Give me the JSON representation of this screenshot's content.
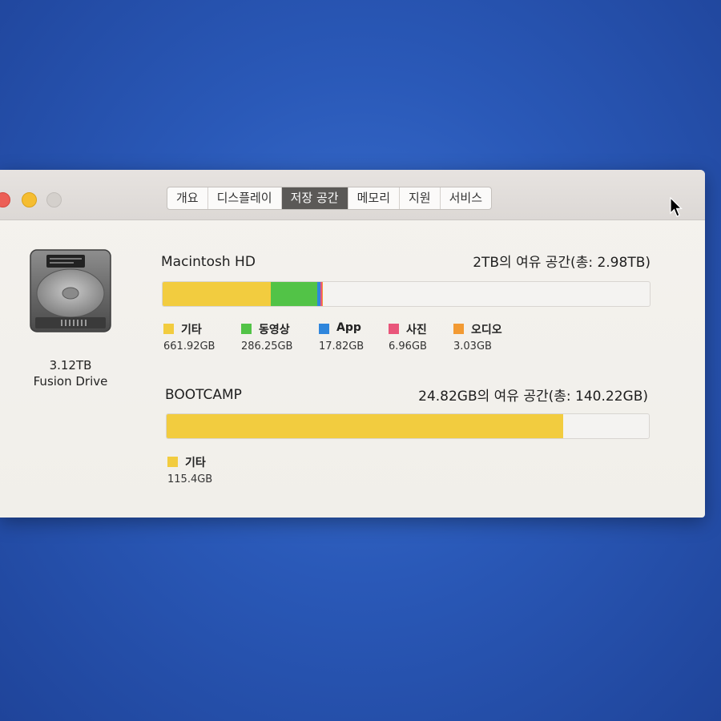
{
  "tabs": [
    {
      "label": "개요",
      "active": false
    },
    {
      "label": "디스플레이",
      "active": false
    },
    {
      "label": "저장 공간",
      "active": true
    },
    {
      "label": "메모리",
      "active": false
    },
    {
      "label": "지원",
      "active": false
    },
    {
      "label": "서비스",
      "active": false
    }
  ],
  "disk": {
    "size": "3.12TB",
    "type": "Fusion Drive",
    "icon": "hard-drive-icon"
  },
  "volumes": [
    {
      "name": "Macintosh HD",
      "free_text": "2TB의 여유 공간(총: 2.98TB)",
      "total_gb": 2980,
      "categories": [
        {
          "label": "기타",
          "value": "661.92GB",
          "gb": 661.92,
          "color": "#f2cc3f"
        },
        {
          "label": "동영상",
          "value": "286.25GB",
          "gb": 286.25,
          "color": "#52c347"
        },
        {
          "label": "App",
          "value": "17.82GB",
          "gb": 17.82,
          "color": "#2f86dc"
        },
        {
          "label": "사진",
          "value": "6.96GB",
          "gb": 6.96,
          "color": "#e9557a"
        },
        {
          "label": "오디오",
          "value": "3.03GB",
          "gb": 3.03,
          "color": "#f29a33"
        }
      ]
    },
    {
      "name": "BOOTCAMP",
      "free_text": "24.82GB의 여유 공간(총: 140.22GB)",
      "total_gb": 140.22,
      "categories": [
        {
          "label": "기타",
          "value": "115.4GB",
          "gb": 115.4,
          "color": "#f2cc3f"
        }
      ]
    }
  ]
}
